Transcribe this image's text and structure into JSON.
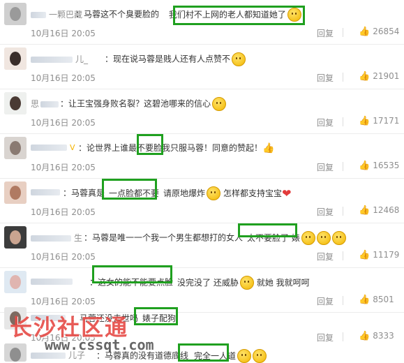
{
  "comments": [
    {
      "author_suffix": "一颗巴藏",
      "content_pre": "：马蓉这不个臭要脸的",
      "content_mid": "我们村不上网的老人都知道她了",
      "content_post": "",
      "date": "10月16日 20:05",
      "reply": "回复",
      "likes": "26854"
    },
    {
      "author_suffix": "儿_",
      "content_pre": "：现在说马蓉是贱人还有人点赞不",
      "content_mid": "",
      "content_post": "",
      "date": "10月16日 20:05",
      "reply": "回复",
      "likes": "21901"
    },
    {
      "author_suffix": "思",
      "content_pre": "：让王宝强身败名裂？这碧池哪来的信心",
      "content_mid": "",
      "content_post": "",
      "date": "10月16日 20:05",
      "reply": "回复",
      "likes": "17171"
    },
    {
      "author_suffix": "",
      "content_pre": "：论世界上谁最",
      "content_mid": "不要脸",
      "content_post": "我只服马蓉！同意的赞起！",
      "date": "10月16日 20:05",
      "reply": "回复",
      "likes": "16535"
    },
    {
      "author_suffix": "",
      "content_pre": "：马蓉真是",
      "content_mid": "一点脸都不要",
      "content_post": "请原地爆炸",
      "content_tail": "怎样都支持宝宝",
      "date": "10月16日 20:05",
      "reply": "回复",
      "likes": "12468"
    },
    {
      "author_suffix": "生",
      "content_pre": "：马蓉是唯一一个我一个男生都想打的女人",
      "content_mid": "太不要脸了 婊",
      "content_post": "",
      "date": "10月16日 20:05",
      "reply": "回复",
      "likes": "11179"
    },
    {
      "author_suffix": "",
      "content_pre": "：",
      "content_mid": "这女的能不能要点脸",
      "content_post": "没完没了 还威胁",
      "content_tail": "就她 我就呵呵",
      "date": "10月16日 20:05",
      "reply": "回复",
      "likes": "8501"
    },
    {
      "author_suffix": "",
      "content_pre": "：马蓉还没去世吗",
      "content_mid": "婊子配狗",
      "content_post": "",
      "date": "10月16日 20:05",
      "reply": "回复",
      "likes": "8333"
    },
    {
      "author_suffix": "儿子",
      "content_pre": "：马蓉真的没有道德底线",
      "content_mid": "完全一人道",
      "content_post": "",
      "date": "",
      "reply": "",
      "likes": ""
    }
  ],
  "watermark": {
    "line1": "长沙社区通",
    "line2": "www.cssqt.com"
  },
  "colors": {
    "highlight": "#1fa01f",
    "watermark_red": "#e64a45"
  }
}
